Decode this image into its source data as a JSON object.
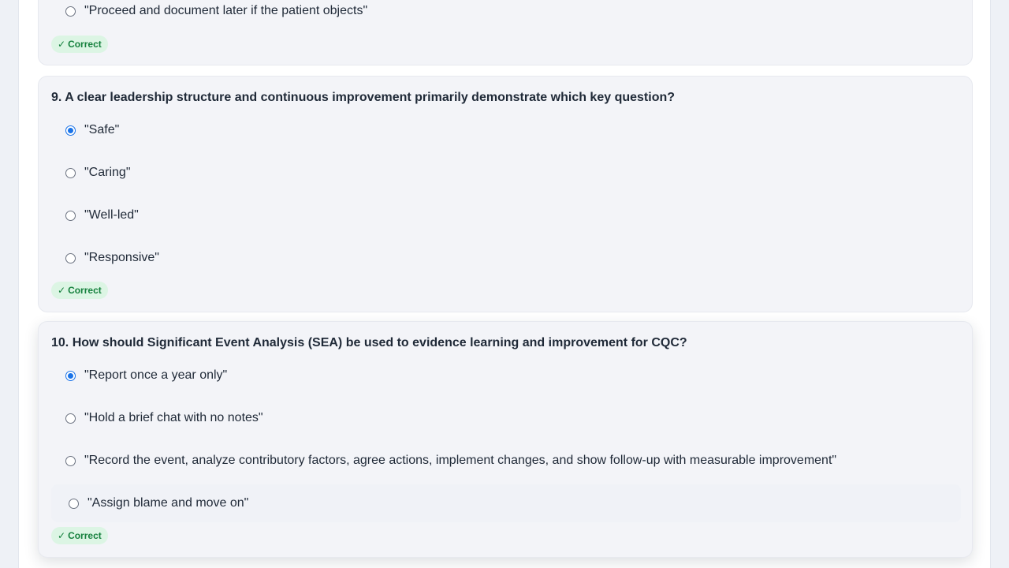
{
  "questions": [
    {
      "title": "",
      "options": [
        {
          "label": "\"Proceed and document later if the patient objects\"",
          "selected": false
        }
      ],
      "result": "Correct"
    },
    {
      "title": "9. A clear leadership structure and continuous improvement primarily demonstrate which key question?",
      "options": [
        {
          "label": "\"Safe\"",
          "selected": true
        },
        {
          "label": "\"Caring\"",
          "selected": false
        },
        {
          "label": "\"Well-led\"",
          "selected": false
        },
        {
          "label": "\"Responsive\"",
          "selected": false
        }
      ],
      "result": "Correct"
    },
    {
      "title": "10. How should Significant Event Analysis (SEA) be used to evidence learning and improvement for CQC?",
      "options": [
        {
          "label": "\"Report once a year only\"",
          "selected": true
        },
        {
          "label": "\"Hold a brief chat with no notes\"",
          "selected": false
        },
        {
          "label": "\"Record the event, analyze contributory factors, agree actions, implement changes, and show follow-up with measurable improvement\"",
          "selected": false
        },
        {
          "label": "\"Assign blame and move on\"",
          "selected": false
        }
      ],
      "result": "Correct"
    }
  ],
  "icons": {
    "result_icon": "checkmark-icon",
    "check_glyph": "✓"
  },
  "colors": {
    "accent": "#1a73e8",
    "correct_text": "#15803d",
    "correct_bg": "#dcf5e4"
  }
}
